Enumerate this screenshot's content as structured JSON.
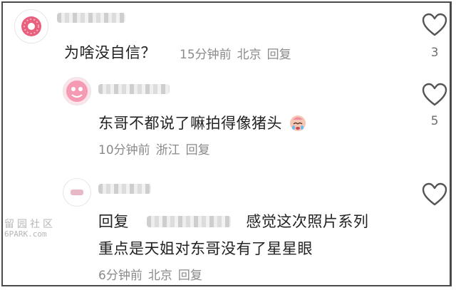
{
  "comments": [
    {
      "text": "为啥没自信？",
      "time": "15分钟前",
      "location": "北京",
      "reply_label": "回复",
      "like_count": "3"
    },
    {
      "text": "东哥不都说了嘛拍得像猪头",
      "time": "10分钟前",
      "location": "浙江",
      "reply_label": "回复",
      "like_count": "5"
    },
    {
      "reply_prefix": "回复",
      "line1_suffix": "感觉这次照片系列",
      "line2": "重点是天姐对东哥没有了星星眼",
      "time": "6分钟前",
      "location": "北京",
      "reply_label": "回复"
    }
  ],
  "watermark": {
    "cjk": "留园社区",
    "latin": "6PARK.com"
  },
  "icons": [
    "heart-icon",
    "avatar-donut",
    "avatar-pink",
    "crying-emoji"
  ]
}
